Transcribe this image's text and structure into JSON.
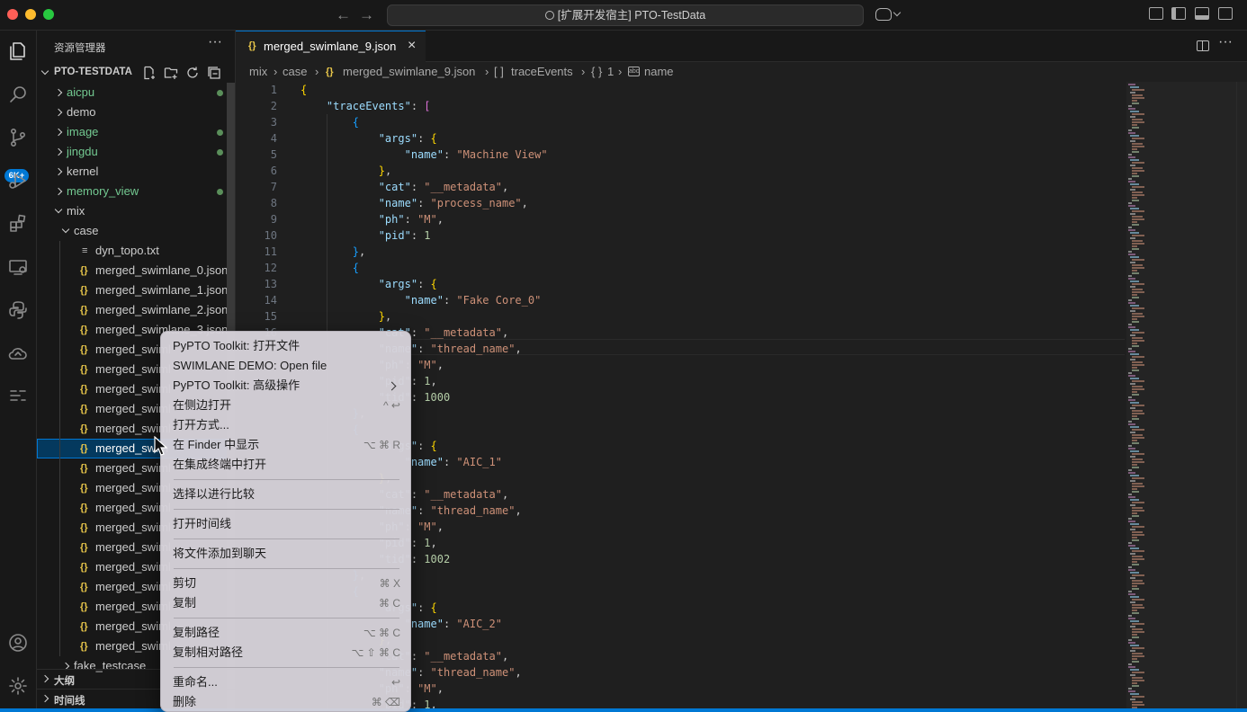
{
  "titlebar": {
    "title": "[扩展开发宿主] PTO-TestData",
    "back_icon": "arrow-left-icon",
    "forward_icon": "arrow-right-icon"
  },
  "activity": {
    "source_control_badge": "6K+"
  },
  "explorer": {
    "title": "资源管理器",
    "root": "PTO-TESTDATA",
    "items": [
      {
        "name": "aicpu",
        "type": "folder",
        "expanded": false,
        "modified": true,
        "color": "#73c991"
      },
      {
        "name": "demo",
        "type": "folder",
        "expanded": false,
        "modified": false,
        "color": "#cccccc"
      },
      {
        "name": "image",
        "type": "folder",
        "expanded": false,
        "modified": true,
        "color": "#73c991"
      },
      {
        "name": "jingdu",
        "type": "folder",
        "expanded": false,
        "modified": true,
        "color": "#73c991"
      },
      {
        "name": "kernel",
        "type": "folder",
        "expanded": false,
        "modified": false,
        "color": "#cccccc"
      },
      {
        "name": "memory_view",
        "type": "folder",
        "expanded": false,
        "modified": true,
        "color": "#73c991"
      },
      {
        "name": "mix",
        "type": "folder",
        "expanded": true,
        "modified": false,
        "color": "#cccccc"
      },
      {
        "name": "case",
        "type": "folder",
        "expanded": true,
        "modified": false,
        "color": "#cccccc"
      },
      {
        "name": "dyn_topo.txt",
        "type": "txt",
        "color": "#cccccc"
      },
      {
        "name": "merged_swimlane_0.json",
        "type": "json",
        "color": "#cccccc"
      },
      {
        "name": "merged_swimlane_1.json",
        "type": "json",
        "color": "#cccccc"
      },
      {
        "name": "merged_swimlane_2.json",
        "type": "json",
        "color": "#cccccc"
      },
      {
        "name": "merged_swimlane_3.json",
        "type": "json",
        "color": "#cccccc"
      },
      {
        "name": "merged_swiml",
        "type": "json",
        "color": "#cccccc"
      },
      {
        "name": "merged_swiml",
        "type": "json",
        "color": "#cccccc"
      },
      {
        "name": "merged_swiml",
        "type": "json",
        "color": "#cccccc"
      },
      {
        "name": "merged_swiml",
        "type": "json",
        "color": "#cccccc"
      },
      {
        "name": "merged_swiml",
        "type": "json",
        "color": "#cccccc"
      },
      {
        "name": "merged_swim",
        "type": "json",
        "color": "#ffffff",
        "selected": true
      },
      {
        "name": "merged_swiml",
        "type": "json",
        "color": "#cccccc"
      },
      {
        "name": "merged_swiml",
        "type": "json",
        "color": "#cccccc"
      },
      {
        "name": "merged_swiml",
        "type": "json",
        "color": "#cccccc"
      },
      {
        "name": "merged_swiml",
        "type": "json",
        "color": "#cccccc"
      },
      {
        "name": "merged_swiml",
        "type": "json",
        "color": "#cccccc"
      },
      {
        "name": "merged_swiml",
        "type": "json",
        "color": "#cccccc"
      },
      {
        "name": "merged_swiml",
        "type": "json",
        "color": "#cccccc"
      },
      {
        "name": "merged_swiml",
        "type": "json",
        "color": "#cccccc"
      },
      {
        "name": "merged_swiml",
        "type": "json",
        "color": "#cccccc"
      },
      {
        "name": "merged_swiml",
        "type": "json",
        "color": "#cccccc"
      },
      {
        "name": "fake_testcase",
        "type": "folder",
        "expanded": false,
        "color": "#cccccc"
      }
    ],
    "outline_label": "大纲",
    "timeline_label": "时间线"
  },
  "tab": {
    "label": "merged_swimlane_9.json"
  },
  "breadcrumb": [
    "mix",
    "case",
    "merged_swimlane_9.json",
    "traceEvents",
    "1",
    "name"
  ],
  "code_lines": [
    [
      [
        "{",
        "b1"
      ]
    ],
    [
      [
        "    ",
        ""
      ],
      [
        "\"traceEvents\"",
        "k"
      ],
      [
        ": ",
        "p"
      ],
      [
        "[",
        "b2"
      ]
    ],
    [
      [
        "        ",
        ""
      ],
      [
        "{",
        "b3"
      ]
    ],
    [
      [
        "            ",
        ""
      ],
      [
        "\"args\"",
        "k"
      ],
      [
        ": ",
        "p"
      ],
      [
        "{",
        "b1"
      ]
    ],
    [
      [
        "                ",
        ""
      ],
      [
        "\"name\"",
        "k"
      ],
      [
        ": ",
        "p"
      ],
      [
        "\"Machine View\"",
        "s"
      ]
    ],
    [
      [
        "            ",
        ""
      ],
      [
        "}",
        "b1"
      ],
      [
        ",",
        "p"
      ]
    ],
    [
      [
        "            ",
        ""
      ],
      [
        "\"cat\"",
        "k"
      ],
      [
        ": ",
        "p"
      ],
      [
        "\"__metadata\"",
        "s"
      ],
      [
        ",",
        "p"
      ]
    ],
    [
      [
        "            ",
        ""
      ],
      [
        "\"name\"",
        "k"
      ],
      [
        ": ",
        "p"
      ],
      [
        "\"process_name\"",
        "s"
      ],
      [
        ",",
        "p"
      ]
    ],
    [
      [
        "            ",
        ""
      ],
      [
        "\"ph\"",
        "k"
      ],
      [
        ": ",
        "p"
      ],
      [
        "\"M\"",
        "s"
      ],
      [
        ",",
        "p"
      ]
    ],
    [
      [
        "            ",
        ""
      ],
      [
        "\"pid\"",
        "k"
      ],
      [
        ": ",
        "p"
      ],
      [
        "1",
        "n"
      ]
    ],
    [
      [
        "        ",
        ""
      ],
      [
        "}",
        "b3"
      ],
      [
        ",",
        "p"
      ]
    ],
    [
      [
        "        ",
        ""
      ],
      [
        "{",
        "b3"
      ]
    ],
    [
      [
        "            ",
        ""
      ],
      [
        "\"args\"",
        "k"
      ],
      [
        ": ",
        "p"
      ],
      [
        "{",
        "b1"
      ]
    ],
    [
      [
        "                ",
        ""
      ],
      [
        "\"name\"",
        "k"
      ],
      [
        ": ",
        "p"
      ],
      [
        "\"Fake Core_0\"",
        "s"
      ]
    ],
    [
      [
        "            ",
        ""
      ],
      [
        "}",
        "b1"
      ],
      [
        ",",
        "p"
      ]
    ],
    [
      [
        "            ",
        ""
      ],
      [
        "\"cat\"",
        "k"
      ],
      [
        ": ",
        "p"
      ],
      [
        "\"__metadata\"",
        "s"
      ],
      [
        ",",
        "p"
      ]
    ],
    [
      [
        "            ",
        ""
      ],
      [
        "\"name\"",
        "k"
      ],
      [
        ": ",
        "p"
      ],
      [
        "\"thread_name\"",
        "s"
      ],
      [
        ",",
        "p"
      ]
    ],
    [
      [
        "            ",
        ""
      ],
      [
        "\"ph\"",
        "k"
      ],
      [
        ": ",
        "p"
      ],
      [
        "\"M\"",
        "s"
      ],
      [
        ",",
        "p"
      ]
    ],
    [
      [
        "            ",
        ""
      ],
      [
        "\"pid\"",
        "k"
      ],
      [
        ": ",
        "p"
      ],
      [
        "1",
        "n"
      ],
      [
        ",",
        "p"
      ]
    ],
    [
      [
        "            ",
        ""
      ],
      [
        "\"tid\"",
        "k"
      ],
      [
        ": ",
        "p"
      ],
      [
        "1000",
        "n"
      ]
    ],
    [
      [
        "        ",
        ""
      ],
      [
        "}",
        "b3"
      ],
      [
        ",",
        "p"
      ]
    ],
    [
      [
        "        ",
        ""
      ],
      [
        "{",
        "b3"
      ]
    ],
    [
      [
        "            ",
        ""
      ],
      [
        "\"args\"",
        "k"
      ],
      [
        ": ",
        "p"
      ],
      [
        "{",
        "b1"
      ]
    ],
    [
      [
        "                ",
        ""
      ],
      [
        "\"name\"",
        "k"
      ],
      [
        ": ",
        "p"
      ],
      [
        "\"AIC_1\"",
        "s"
      ]
    ],
    [
      [
        "            ",
        ""
      ],
      [
        "}",
        "b1"
      ],
      [
        ",",
        "p"
      ]
    ],
    [
      [
        "            ",
        ""
      ],
      [
        "\"cat\"",
        "k"
      ],
      [
        ": ",
        "p"
      ],
      [
        "\"__metadata\"",
        "s"
      ],
      [
        ",",
        "p"
      ]
    ],
    [
      [
        "            ",
        ""
      ],
      [
        "\"name\"",
        "k"
      ],
      [
        ": ",
        "p"
      ],
      [
        "\"thread_name\"",
        "s"
      ],
      [
        ",",
        "p"
      ]
    ],
    [
      [
        "            ",
        ""
      ],
      [
        "\"ph\"",
        "k"
      ],
      [
        ": ",
        "p"
      ],
      [
        "\"M\"",
        "s"
      ],
      [
        ",",
        "p"
      ]
    ],
    [
      [
        "            ",
        ""
      ],
      [
        "\"pid\"",
        "k"
      ],
      [
        ": ",
        "p"
      ],
      [
        "1",
        "n"
      ],
      [
        ",",
        "p"
      ]
    ],
    [
      [
        "            ",
        ""
      ],
      [
        "\"tid\"",
        "k"
      ],
      [
        ": ",
        "p"
      ],
      [
        "1002",
        "n"
      ]
    ],
    [
      [
        "        ",
        ""
      ],
      [
        "}",
        "b3"
      ],
      [
        ",",
        "p"
      ]
    ],
    [
      [
        "        ",
        ""
      ],
      [
        "{",
        "b3"
      ]
    ],
    [
      [
        "            ",
        ""
      ],
      [
        "\"args\"",
        "k"
      ],
      [
        ": ",
        "p"
      ],
      [
        "{",
        "b1"
      ]
    ],
    [
      [
        "                ",
        ""
      ],
      [
        "\"name\"",
        "k"
      ],
      [
        ": ",
        "p"
      ],
      [
        "\"AIC_2\"",
        "s"
      ]
    ],
    [
      [
        "            ",
        ""
      ],
      [
        "}",
        "b1"
      ],
      [
        ",",
        "p"
      ]
    ],
    [
      [
        "            ",
        ""
      ],
      [
        "\"cat\"",
        "k"
      ],
      [
        ": ",
        "p"
      ],
      [
        "\"__metadata\"",
        "s"
      ],
      [
        ",",
        "p"
      ]
    ],
    [
      [
        "            ",
        ""
      ],
      [
        "\"name\"",
        "k"
      ],
      [
        ": ",
        "p"
      ],
      [
        "\"thread_name\"",
        "s"
      ],
      [
        ",",
        "p"
      ]
    ],
    [
      [
        "            ",
        ""
      ],
      [
        "\"ph\"",
        "k"
      ],
      [
        ": ",
        "p"
      ],
      [
        "\"M\"",
        "s"
      ],
      [
        ",",
        "p"
      ]
    ],
    [
      [
        "            ",
        ""
      ],
      [
        "\"pid\"",
        "k"
      ],
      [
        ": ",
        "p"
      ],
      [
        "1",
        "n"
      ],
      [
        ",",
        "p"
      ]
    ]
  ],
  "visible_line_numbers": [
    "1",
    "2",
    "3",
    "4",
    "5",
    "6",
    "7",
    "8",
    "9",
    "10",
    "11",
    "12",
    "13",
    "14",
    "15",
    "16"
  ],
  "context_menu": {
    "items": [
      {
        "label": "PyPTO Toolkit: 打开文件",
        "shortcut": ""
      },
      {
        "label": "SWIMLANE DEMO: Open file",
        "shortcut": ""
      },
      {
        "label": "PyPTO Toolkit: 高级操作",
        "shortcut": "",
        "submenu": true
      },
      {
        "label": "在侧边打开",
        "shortcut": "^↩"
      },
      {
        "label": "打开方式...",
        "shortcut": ""
      },
      {
        "label": "在 Finder 中显示",
        "shortcut": "⌥⌘R"
      },
      {
        "label": "在集成终端中打开",
        "shortcut": ""
      },
      {
        "sep": true
      },
      {
        "label": "选择以进行比较",
        "shortcut": ""
      },
      {
        "sep": true
      },
      {
        "label": "打开时间线",
        "shortcut": ""
      },
      {
        "sep": true
      },
      {
        "label": "将文件添加到聊天",
        "shortcut": ""
      },
      {
        "sep": true
      },
      {
        "label": "剪切",
        "shortcut": "⌘X"
      },
      {
        "label": "复制",
        "shortcut": "⌘C"
      },
      {
        "sep": true
      },
      {
        "label": "复制路径",
        "shortcut": "⌥⌘C"
      },
      {
        "label": "复制相对路径",
        "shortcut": "⌥⇧⌘C"
      },
      {
        "sep": true
      },
      {
        "label": "重命名...",
        "shortcut": "↩"
      },
      {
        "label": "删除",
        "shortcut": "⌘⌫"
      }
    ]
  }
}
